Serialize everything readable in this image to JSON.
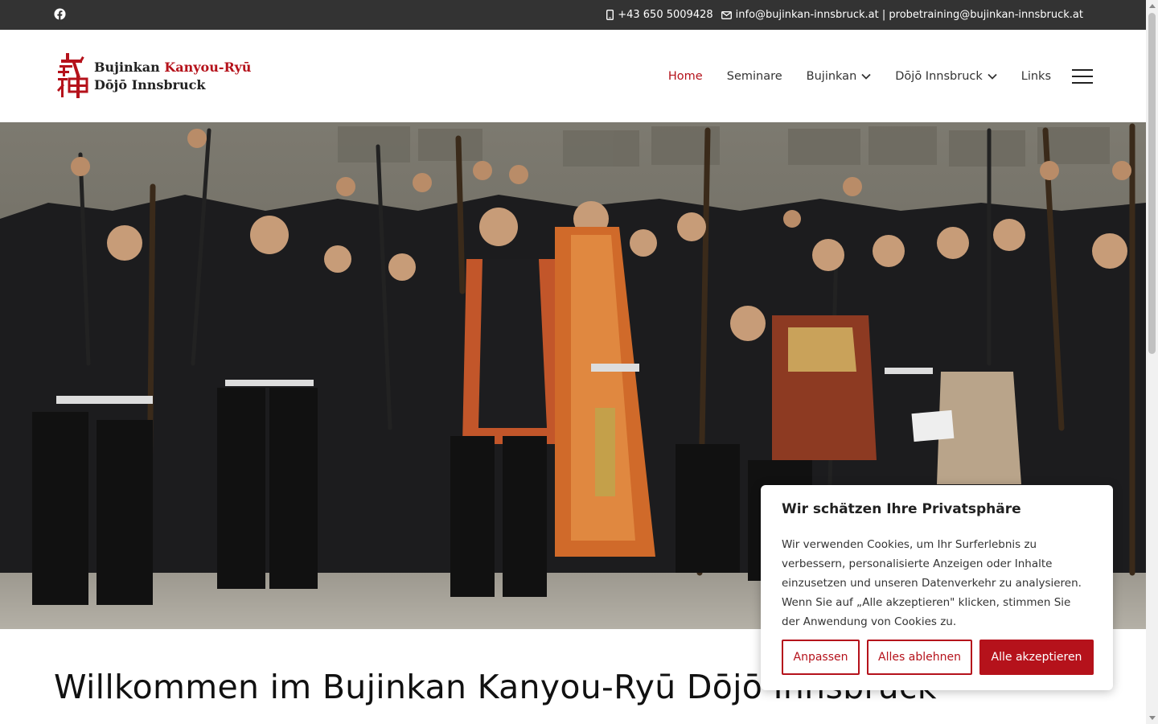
{
  "topbar": {
    "phone": "+43 650 5009428",
    "emails": "info@bujinkan-innsbruck.at | probetraining@bujinkan-innsbruck.at"
  },
  "logo": {
    "line1_a": "Bujinkan",
    "line1_b": "Kanyou-Ryū",
    "line2": "Dōjō Innsbruck"
  },
  "nav": {
    "items": [
      {
        "label": "Home",
        "active": true
      },
      {
        "label": "Seminare"
      },
      {
        "label": "Bujinkan",
        "dropdown": true
      },
      {
        "label": "Dōjō Innsbruck",
        "dropdown": true
      },
      {
        "label": "Links"
      }
    ]
  },
  "main": {
    "heading": "Willkommen im Bujinkan Kanyou-Ryū Dōjō Innsbruck"
  },
  "cookie": {
    "title": "Wir schätzen Ihre Privatsphäre",
    "text": "Wir verwenden Cookies, um Ihr Surferlebnis zu verbessern, personalisierte Anzeigen oder Inhalte einzusetzen und unseren Datenverkehr zu analysieren. Wenn Sie auf „Alle akzeptieren\" klicken, stimmen Sie der Anwendung von Cookies zu.",
    "btn_customize": "Anpassen",
    "btn_reject": "Alles ablehnen",
    "btn_accept": "Alle akzeptieren"
  },
  "colors": {
    "accent": "#b5121b",
    "topbar": "#333333"
  }
}
